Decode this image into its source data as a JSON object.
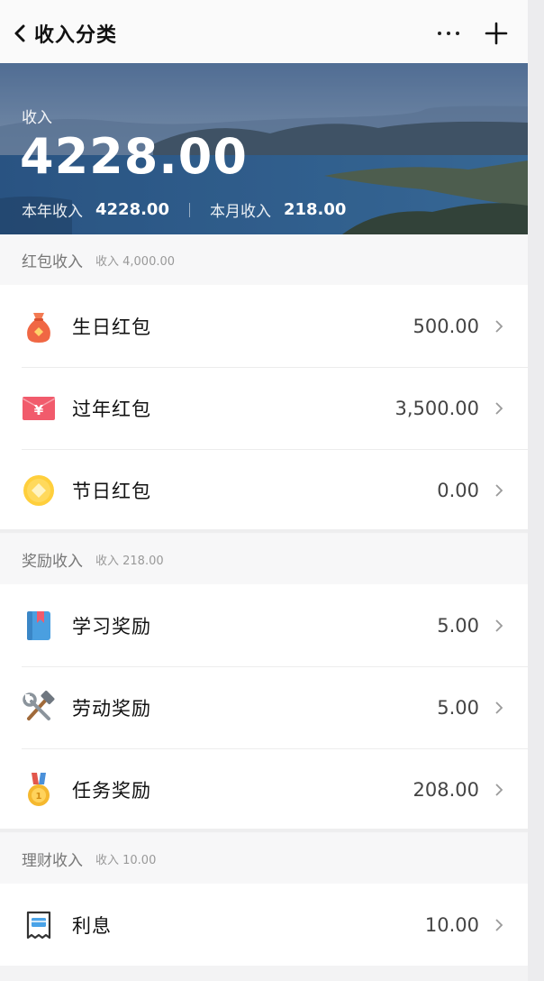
{
  "header": {
    "title": "收入分类",
    "more_icon": "more-dots-icon",
    "add_icon": "plus-icon"
  },
  "banner": {
    "label": "收入",
    "total": "4228.00",
    "year_label": "本年收入",
    "year_value": "4228.00",
    "month_label": "本月收入",
    "month_value": "218.00"
  },
  "sections": [
    {
      "title": "红包收入",
      "subtitle": "收入 4,000.00",
      "items": [
        {
          "label": "生日红包",
          "value": "500.00",
          "icon": "money-bag-icon"
        },
        {
          "label": "过年红包",
          "value": "3,500.00",
          "icon": "red-envelope-yen-icon"
        },
        {
          "label": "节日红包",
          "value": "0.00",
          "icon": "gold-coin-icon"
        }
      ]
    },
    {
      "title": "奖励收入",
      "subtitle": "收入 218.00",
      "items": [
        {
          "label": "学习奖励",
          "value": "5.00",
          "icon": "book-icon"
        },
        {
          "label": "劳动奖励",
          "value": "5.00",
          "icon": "hammer-wrench-icon"
        },
        {
          "label": "任务奖励",
          "value": "208.00",
          "icon": "medal-icon"
        }
      ]
    },
    {
      "title": "理财收入",
      "subtitle": "收入 10.00",
      "items": [
        {
          "label": "利息",
          "value": "10.00",
          "icon": "receipt-card-icon"
        }
      ]
    }
  ]
}
